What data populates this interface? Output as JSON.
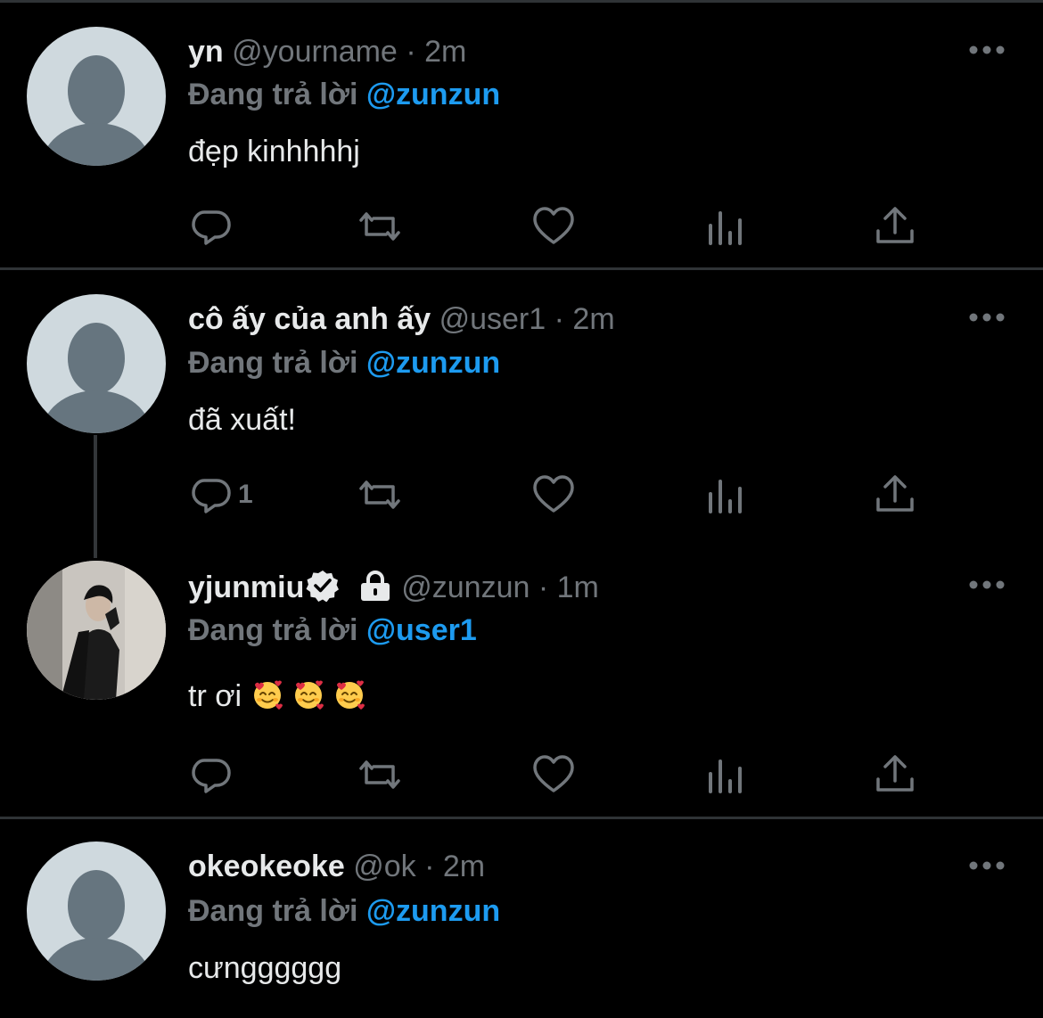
{
  "reply_prefix": "Đang trả lời",
  "colors": {
    "background": "#000000",
    "divider": "#2f3336",
    "muted": "#71767b",
    "text": "#e7e9ea",
    "accent": "#1d9bf0"
  },
  "tweets": [
    {
      "name": "yn",
      "handle": "@yourname",
      "sep": "·",
      "time": "2m",
      "reply_to": "@zunzun",
      "text": "đẹp kinhhhhj",
      "reply_count": ""
    },
    {
      "name": "cô ấy của anh ấy",
      "handle": "@user1",
      "sep": "·",
      "time": "2m",
      "reply_to": "@zunzun",
      "text": "đã xuất!",
      "reply_count": "1"
    },
    {
      "name": "yjunmiu",
      "handle": "@zunzun",
      "sep": "·",
      "time": "1m",
      "reply_to": "@user1",
      "text": "tr ơi",
      "reply_count": "",
      "verified": true,
      "protected": true,
      "emojis": [
        "smiling-face-with-hearts",
        "smiling-face-with-hearts",
        "smiling-face-with-hearts"
      ]
    },
    {
      "name": "okeokeoke",
      "handle": "@ok",
      "sep": "·",
      "time": "2m",
      "reply_to": "@zunzun",
      "text": "cưngggggg",
      "reply_count": ""
    }
  ],
  "icons": {
    "reply": "reply-icon",
    "retweet": "retweet-icon",
    "like": "like-icon",
    "analytics": "analytics-icon",
    "share": "share-icon",
    "more": "more-icon"
  }
}
